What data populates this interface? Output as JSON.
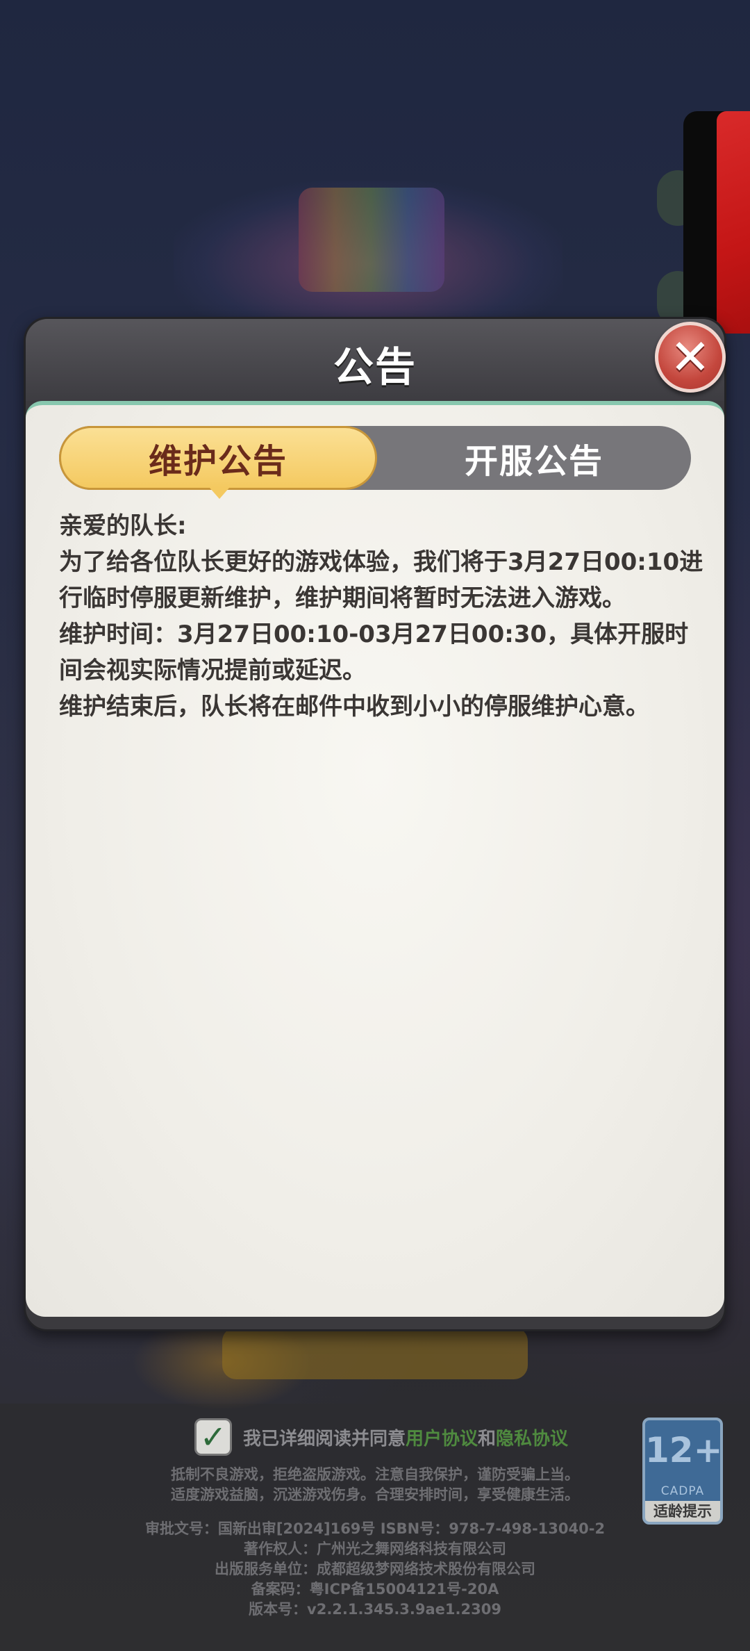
{
  "dialog": {
    "title": "公告",
    "close_icon": "close-icon",
    "tabs": [
      {
        "label": "维护公告",
        "active": true
      },
      {
        "label": "开服公告",
        "active": false
      }
    ],
    "content": [
      "亲爱的队长:",
      "为了给各位队长更好的游戏体验，我们将于3月27日00:10进行临时停服更新维护，维护期间将暂时无法进入游戏。",
      "维护时间：3月27日00:10-03月27日00:30，具体开服时间会视实际情况提前或延迟。",
      "维护结束后，队长将在邮件中收到小小的停服维护心意。"
    ]
  },
  "agreement": {
    "checked": true,
    "prefix": "我已详细阅读并同意",
    "user_agreement": "用户协议",
    "and": "和",
    "privacy_agreement": "隐私协议"
  },
  "age_rating": {
    "number": "12+",
    "org": "CADPA",
    "tip": "适龄提示"
  },
  "footer": {
    "notice_1": "抵制不良游戏，拒绝盗版游戏。注意自我保护，谨防受骗上当。",
    "notice_2": "适度游戏益脑，沉迷游戏伤身。合理安排时间，享受健康生活。",
    "approval": "审批文号：国新出审[2024]169号 ISBN号：978-7-498-13040-2",
    "copyright": "著作权人：广州光之舞网络科技有限公司",
    "publisher": "出版服务单位：成都超级梦网络技术股份有限公司",
    "icp": "备案码：粤ICP备15004121号-20A",
    "version": "版本号：v2.2.1.345.3.9ae1.2309"
  },
  "colors": {
    "tab_active": "#f4c960",
    "body_accent": "#88c7ae",
    "close_button": "#c4473d",
    "link": "#4f8a3f"
  }
}
